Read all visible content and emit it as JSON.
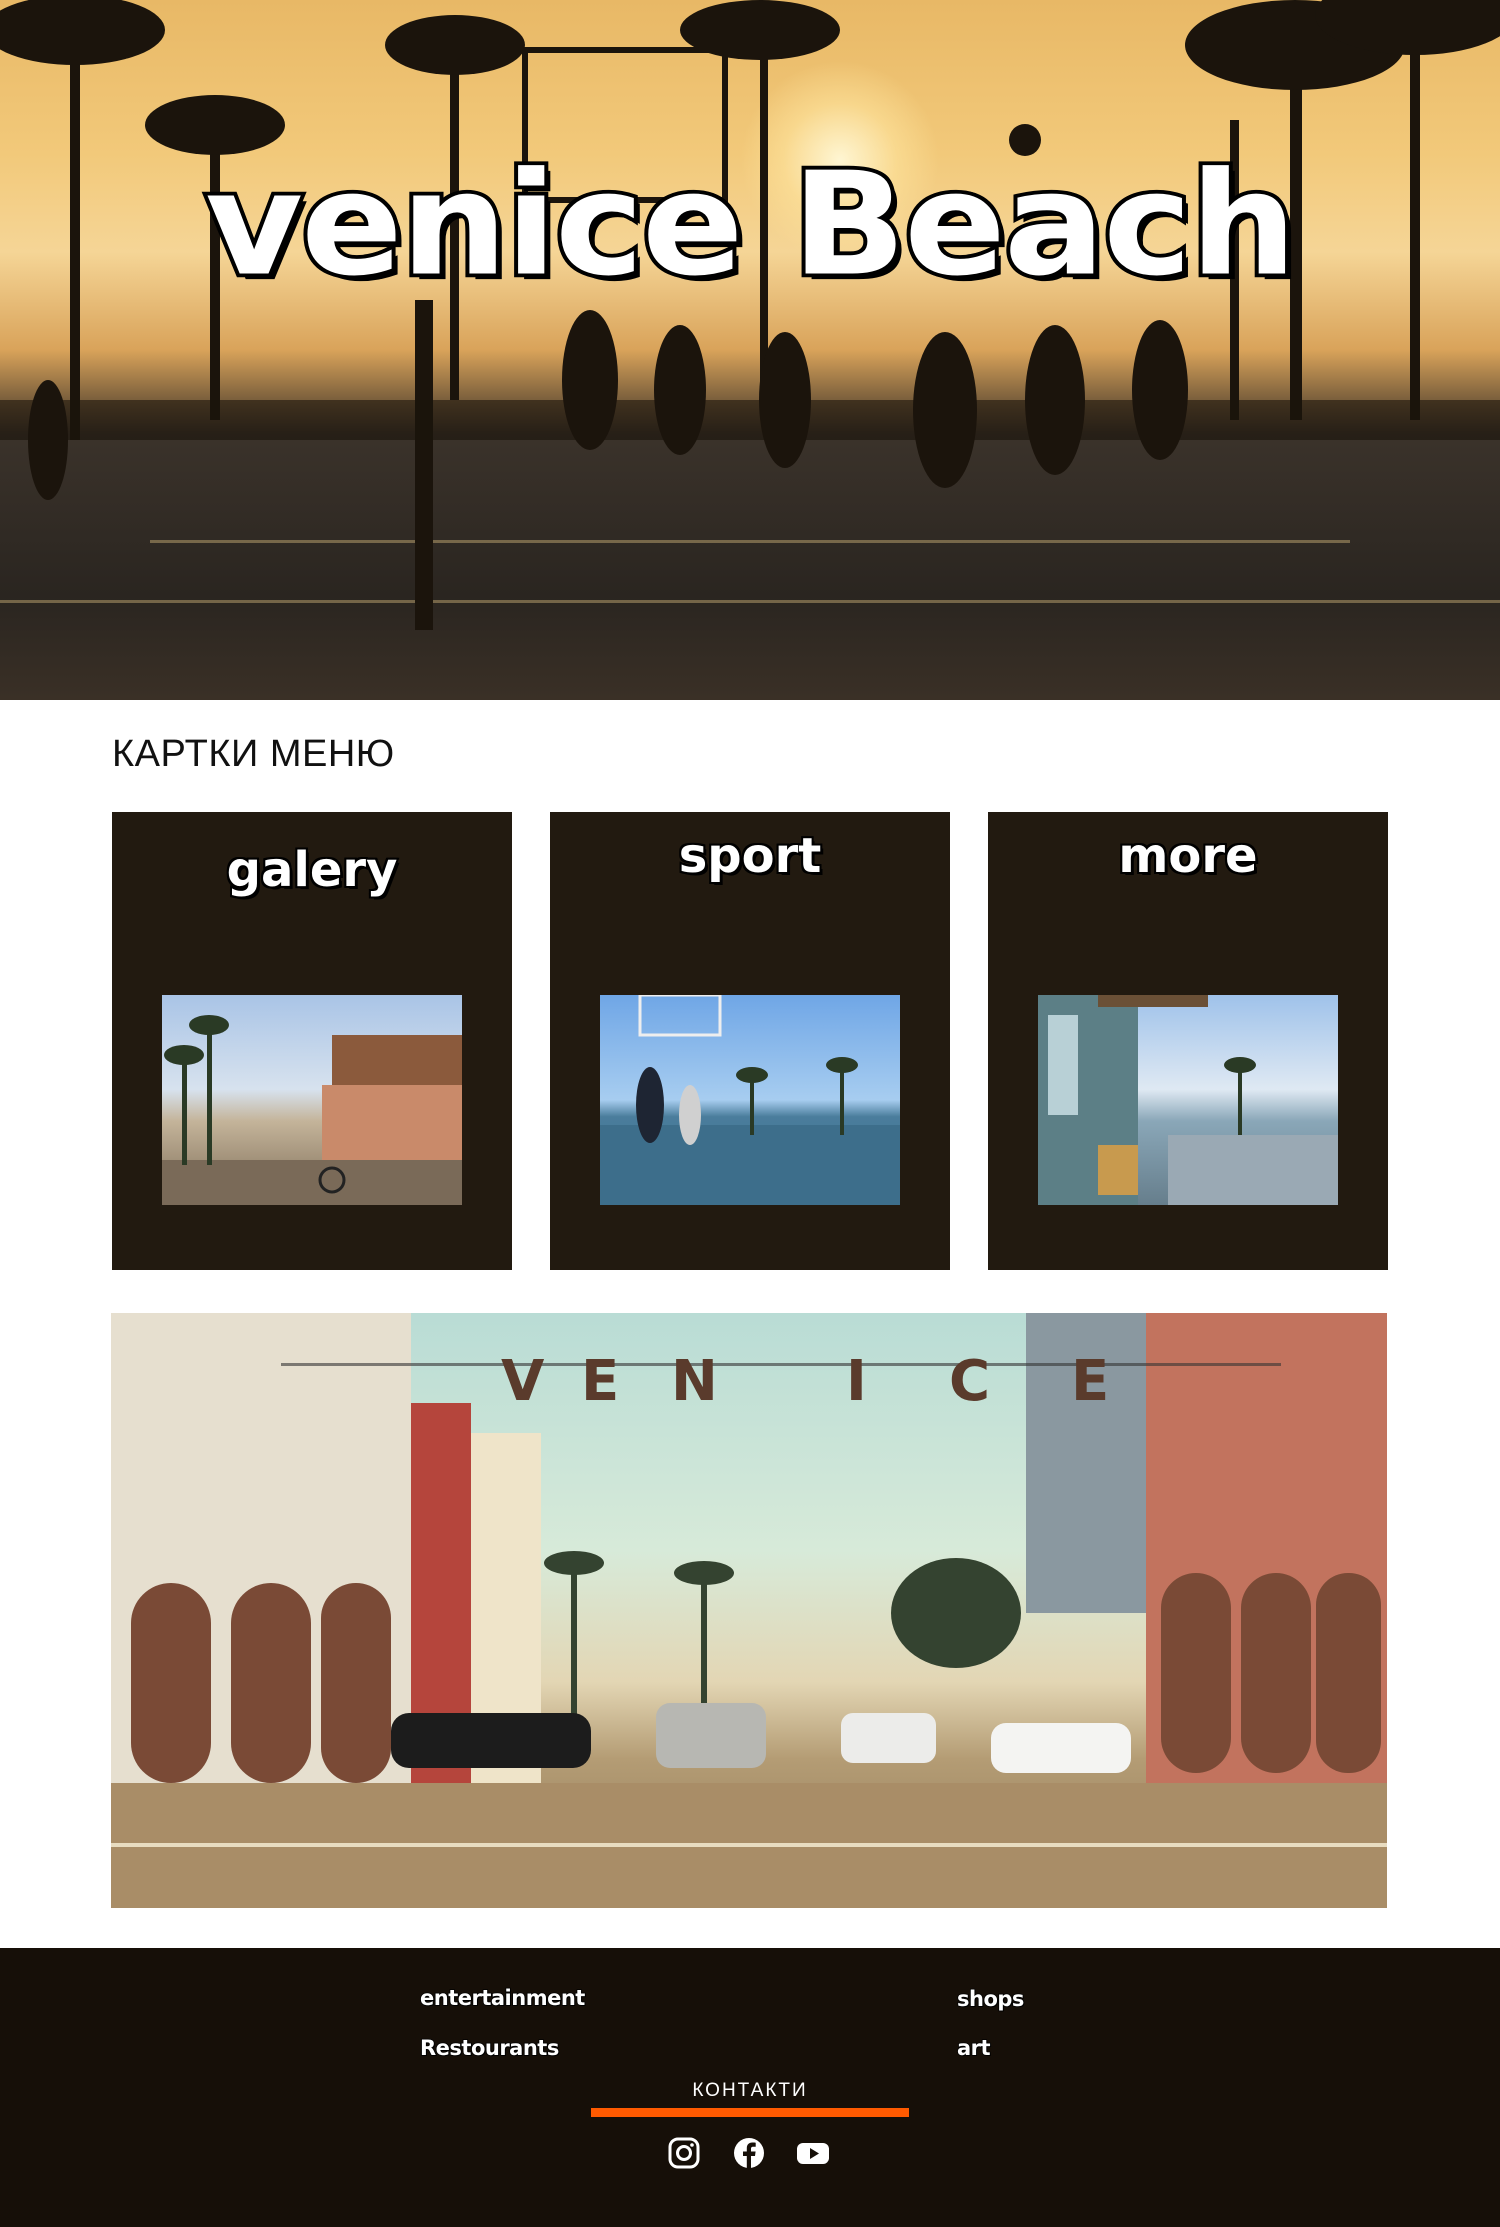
{
  "hero": {
    "title": "venice Beach"
  },
  "section_title": "КАРТКИ МЕНЮ",
  "cards": [
    {
      "title": "galery"
    },
    {
      "title": "sport"
    },
    {
      "title": "more"
    }
  ],
  "big_photo": {
    "sign_letters": [
      "V",
      "E",
      "N",
      "I",
      "C",
      "E"
    ]
  },
  "footer": {
    "links": [
      "entertainment",
      "shops",
      "Restourants",
      "art"
    ],
    "contacts_label": "КОНТАКТИ",
    "accent_color": "#ff5a00",
    "social": [
      "instagram-icon",
      "facebook-icon",
      "youtube-icon"
    ]
  }
}
